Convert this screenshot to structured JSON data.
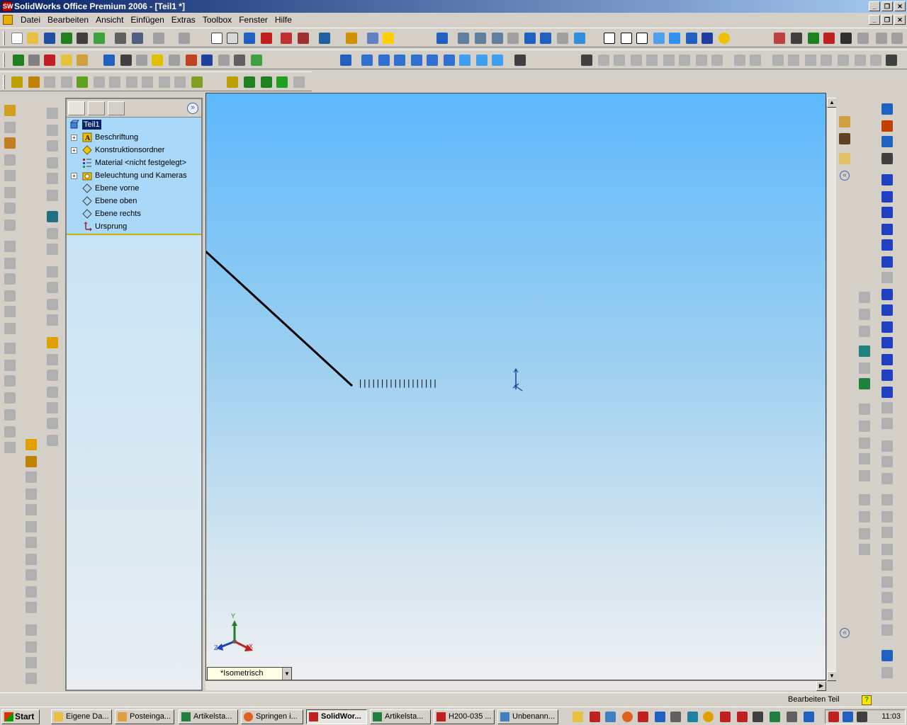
{
  "window": {
    "title": "SolidWorks Office Premium 2006 - [Teil1 *]",
    "app_icon_label": "SW"
  },
  "menu": [
    "Datei",
    "Bearbeiten",
    "Ansicht",
    "Einfügen",
    "Extras",
    "Toolbox",
    "Fenster",
    "Hilfe"
  ],
  "feature_manager": {
    "root": "Teil1",
    "items": [
      {
        "label": "Beschriftung",
        "icon": "annotations-icon",
        "expandable": true
      },
      {
        "label": "Konstruktionsordner",
        "icon": "design-folder-icon",
        "expandable": true
      },
      {
        "label": "Material <nicht festgelegt>",
        "icon": "material-icon",
        "expandable": false
      },
      {
        "label": "Beleuchtung und Kameras",
        "icon": "lights-cameras-icon",
        "expandable": true
      },
      {
        "label": "Ebene vorne",
        "icon": "plane-icon",
        "expandable": false
      },
      {
        "label": "Ebene oben",
        "icon": "plane-icon",
        "expandable": false
      },
      {
        "label": "Ebene rechts",
        "icon": "plane-icon",
        "expandable": false
      },
      {
        "label": "Ursprung",
        "icon": "origin-icon",
        "expandable": false
      }
    ]
  },
  "viewport": {
    "view_name": "*Isometrisch",
    "triad": {
      "x": "X",
      "y": "Y",
      "z": "Z"
    },
    "hatch_text": "||||||||||||||||||"
  },
  "status": {
    "text": "Bearbeiten Teil"
  },
  "taskbar": {
    "start": "Start",
    "buttons": [
      {
        "label": "Eigene Da...",
        "active": false
      },
      {
        "label": "Posteinga...",
        "active": false
      },
      {
        "label": "Artikelsta...",
        "active": false
      },
      {
        "label": "Springen i...",
        "active": false
      },
      {
        "label": "SolidWor...",
        "active": true
      },
      {
        "label": "Artikelsta...",
        "active": false
      },
      {
        "label": "H200-035 ...",
        "active": false
      },
      {
        "label": "Unbenann...",
        "active": false
      }
    ],
    "clock": "11:03"
  },
  "colors": {
    "title_start": "#0a246a",
    "tree_bg": "#a9d8f8",
    "viewport_top": "#5db8fc"
  }
}
